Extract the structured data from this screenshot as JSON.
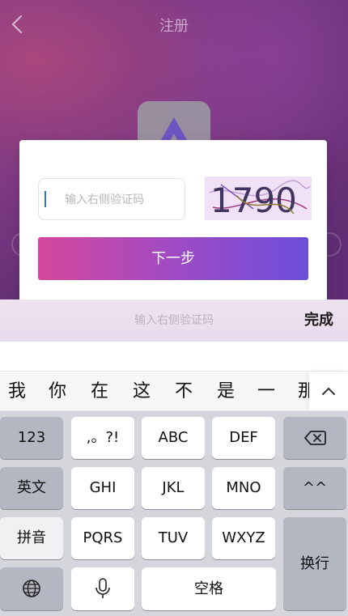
{
  "header": {
    "title": "注册"
  },
  "modal": {
    "input_placeholder": "输入右侧验证码",
    "captcha_text": "1790",
    "next_label": "下一步"
  },
  "accessory": {
    "hint": "输入右侧验证码",
    "done_label": "完成"
  },
  "candidates": [
    "我",
    "你",
    "在",
    "这",
    "不",
    "是",
    "一",
    "那"
  ],
  "keyboard": {
    "row1": [
      "123",
      ",。?!",
      "ABC",
      "DEF"
    ],
    "row2": [
      "英文",
      "GHI",
      "JKL",
      "MNO",
      "^^"
    ],
    "row3": [
      "拼音",
      "PQRS",
      "TUV",
      "WXYZ"
    ],
    "row4_space": "空格",
    "enter": "换行"
  },
  "colors": {
    "button_gradient_start": "#d4489c",
    "button_gradient_end": "#6b4fd9",
    "caret": "#2f6fe6"
  }
}
